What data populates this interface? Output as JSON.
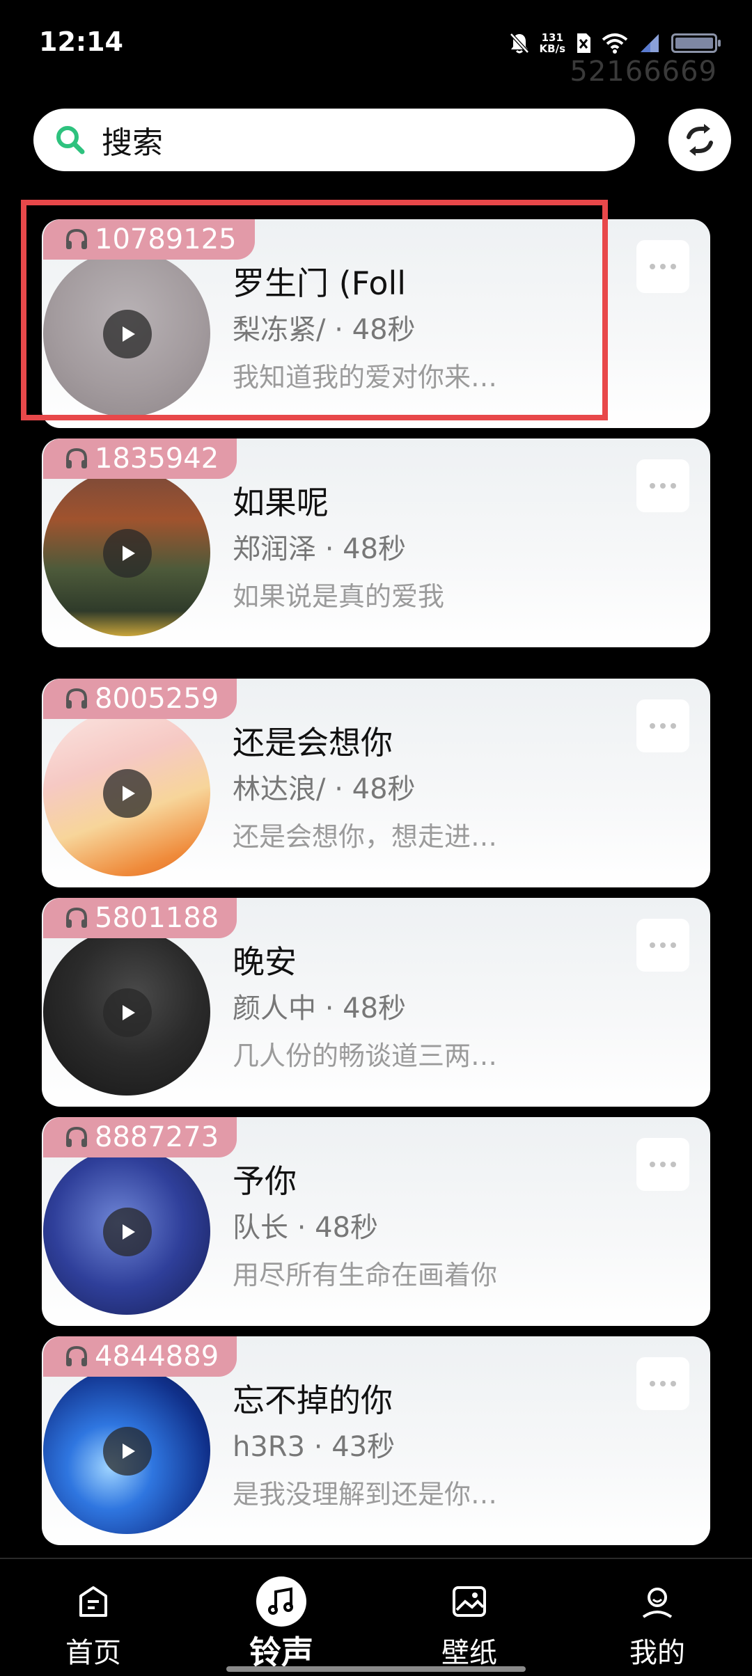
{
  "status_bar": {
    "time": "12:14",
    "net_speed_value": "131",
    "net_speed_unit": "KB/s",
    "watermark": "52166669"
  },
  "search": {
    "placeholder": "搜索"
  },
  "songs": [
    {
      "plays": "10789125",
      "title": "罗生门 (Foll",
      "meta": "梨冻紧/ · 48秒",
      "lyric": "我知道我的爱对你来…"
    },
    {
      "plays": "1835942",
      "title": "如果呢",
      "meta": "郑润泽 · 48秒",
      "lyric": "如果说是真的爱我"
    },
    {
      "plays": "8005259",
      "title": "还是会想你",
      "meta": "林达浪/ · 48秒",
      "lyric": "还是会想你，想走进…"
    },
    {
      "plays": "5801188",
      "title": "晚安",
      "meta": "颜人中 · 48秒",
      "lyric": "几人份的畅谈道三两…"
    },
    {
      "plays": "8887273",
      "title": "予你",
      "meta": "队长 · 48秒",
      "lyric": "用尽所有生命在画着你"
    },
    {
      "plays": "4844889",
      "title": "忘不掉的你",
      "meta": "h3R3 · 43秒",
      "lyric": "是我没理解到还是你…"
    }
  ],
  "nav": {
    "home": "首页",
    "ringtone": "铃声",
    "wallpaper": "壁纸",
    "mine": "我的"
  },
  "colors": {
    "badge": "#e29aa8",
    "highlight": "#e8484a",
    "search_icon": "#2ec27e"
  },
  "icons": [
    "search-icon",
    "refresh-icon",
    "headphones-icon",
    "play-icon",
    "more-icon",
    "home-icon",
    "music-note-icon",
    "image-icon",
    "user-icon"
  ]
}
